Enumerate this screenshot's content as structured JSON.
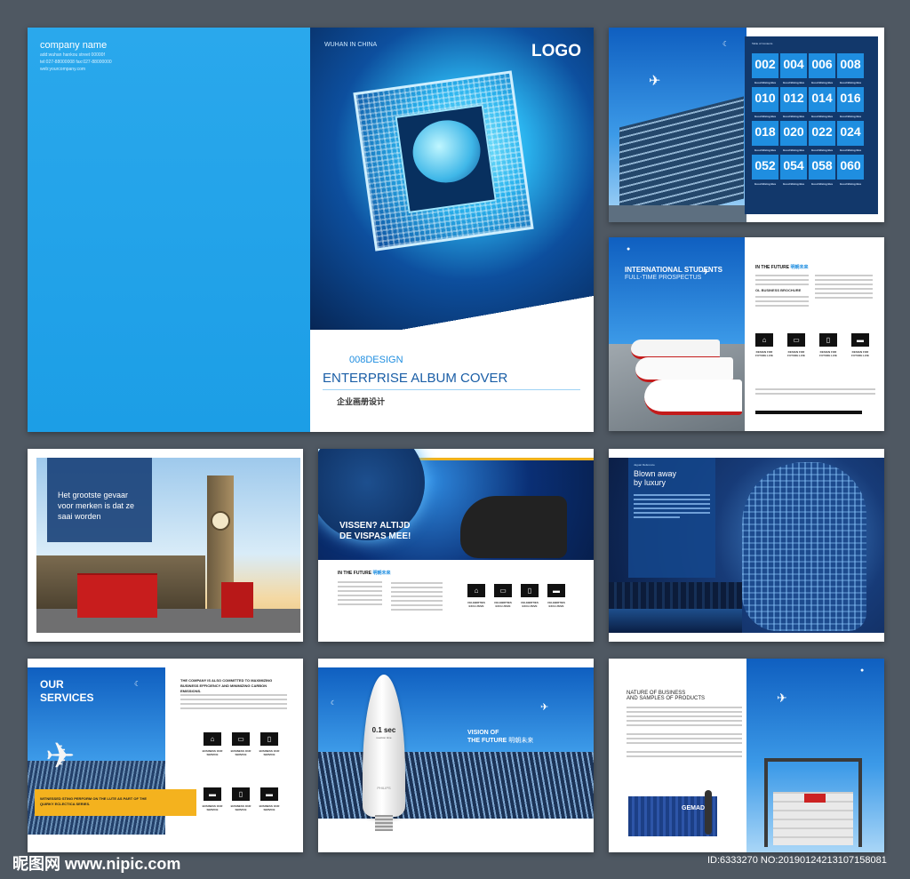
{
  "cover": {
    "company": "company name",
    "address_line1": "add:wuhan hankou street 00000f",
    "address_line2": "tel:027-88000008 fax:027-88000000",
    "address_line3": "web:yourcompany.com",
    "city": "WUHAN IN CHINA",
    "logo": "LOGO",
    "design_code": "008DESIGN",
    "title": "ENTERPRISE ALBUM COVER",
    "subtitle_cn": "企业画册设计"
  },
  "page_building": {
    "heading": "Table of Contents",
    "tiles": [
      "002",
      "004",
      "006",
      "008",
      "010",
      "012",
      "014",
      "016",
      "018",
      "020",
      "022",
      "024",
      "052",
      "054",
      "058",
      "060"
    ],
    "tile_caption": "Good Bixing Bus"
  },
  "page_train": {
    "heading1": "INTERNATIONAL STUDENTS",
    "heading2": "FULL-TIME PROSPECTUS",
    "future": "IN THE FUTURE",
    "future_cn": "明朝未来",
    "sub": "OL BUSINESS BROCHURE",
    "icons": [
      "⌂",
      "▭",
      "▯",
      "▬"
    ],
    "icon_caption": "DESIGN FOR FUTURE LIVE"
  },
  "page_london": {
    "quote": "Het grootste gevaar voor merken is dat ze saai worden"
  },
  "page_swimmer": {
    "headline": "VISSEN? ALTIJD DE VISPAS MEE!",
    "future": "IN THE FUTURE",
    "future_cn": "明朝未来",
    "icons": [
      "⌂",
      "▭",
      "▯",
      "▬"
    ],
    "icon_caption": "CELEBRITIES EXCLUSIVE"
  },
  "page_ai": {
    "label": "Jaguar Reference",
    "title": "Blown away by luxury"
  },
  "page_services": {
    "heading": "OUR SERVICES",
    "intro": "THE COMPANY IS ALSO COMMITTED TO MAXIMIZING BUSINESS EFFICIENCY AND MINIMIZING CARBON EMISSIONS.",
    "banner": "WITNESSED STING PERFORM ON THE LUTE AS PART OF THE QUIRKY ECLECTICA SERIES.",
    "icons": [
      "⌂",
      "▭",
      "▯",
      "▬",
      "▯",
      "▬"
    ],
    "icon_caption": "BUSINESS OUR SERVICE"
  },
  "page_bulb": {
    "speed": "0.1 sec",
    "speed_sub": "reaction time",
    "brand": "PHILIPS",
    "vision1": "VISION OF",
    "vision2": "THE FUTURE",
    "vision_cn": "明朝未来"
  },
  "page_container": {
    "title1": "NATURE OF BUSINESS",
    "title2": "AND SAMPLES OF PRODUCTS",
    "container_text": "GEMADE"
  },
  "watermark": {
    "site_cn": "昵图网",
    "site": "www.nipic.com",
    "id": "ID:6333270 NO:20190124213107158081"
  }
}
